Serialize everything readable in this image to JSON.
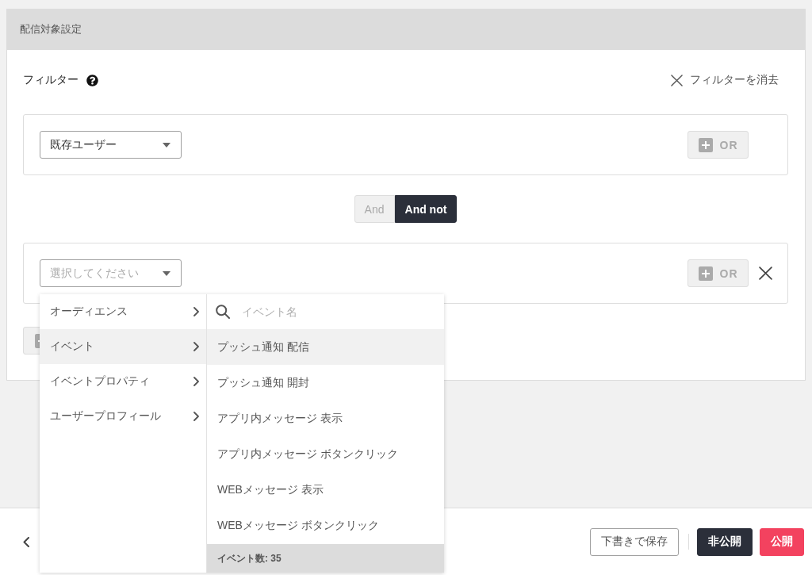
{
  "panel": {
    "title": "配信対象設定"
  },
  "filter_header": {
    "label": "フィルター",
    "clear_label": "フィルターを消去"
  },
  "conditions": [
    {
      "kind": "group",
      "select": {
        "value": "既存ユーザー"
      },
      "or_button": {
        "label": "OR",
        "disabled": true
      },
      "removable": false
    },
    {
      "kind": "join",
      "options": [
        {
          "label": "And",
          "selected": false
        },
        {
          "label": "And not",
          "selected": true
        }
      ]
    },
    {
      "kind": "group",
      "select": {
        "placeholder": "選択してください",
        "menu": {
          "categories": [
            {
              "label": "オーディエンス",
              "selected": false
            },
            {
              "label": "イベント",
              "selected": true
            },
            {
              "label": "イベントプロパティ",
              "selected": false
            },
            {
              "label": "ユーザープロフィール",
              "selected": false
            }
          ],
          "search": {
            "placeholder": "イベント名"
          },
          "events": [
            {
              "label": "プッシュ通知 配信",
              "highlighted": true
            },
            {
              "label": "プッシュ通知 開封",
              "highlighted": false
            },
            {
              "label": "アプリ内メッセージ 表示",
              "highlighted": false
            },
            {
              "label": "アプリ内メッセージ ボタンクリック",
              "highlighted": false
            },
            {
              "label": "WEBメッセージ 表示",
              "highlighted": false
            },
            {
              "label": "WEBメッセージ ボタンクリック",
              "highlighted": false
            }
          ],
          "count": "イベント数: 35"
        }
      },
      "or_button": {
        "label": "OR",
        "disabled": true
      },
      "removable": true
    }
  ],
  "footer": {
    "buttons": [
      {
        "label": "下書きで保存",
        "kind": "outline"
      },
      {
        "label": "非公開",
        "kind": "dark"
      },
      {
        "label": "公開",
        "kind": "danger"
      }
    ]
  }
}
